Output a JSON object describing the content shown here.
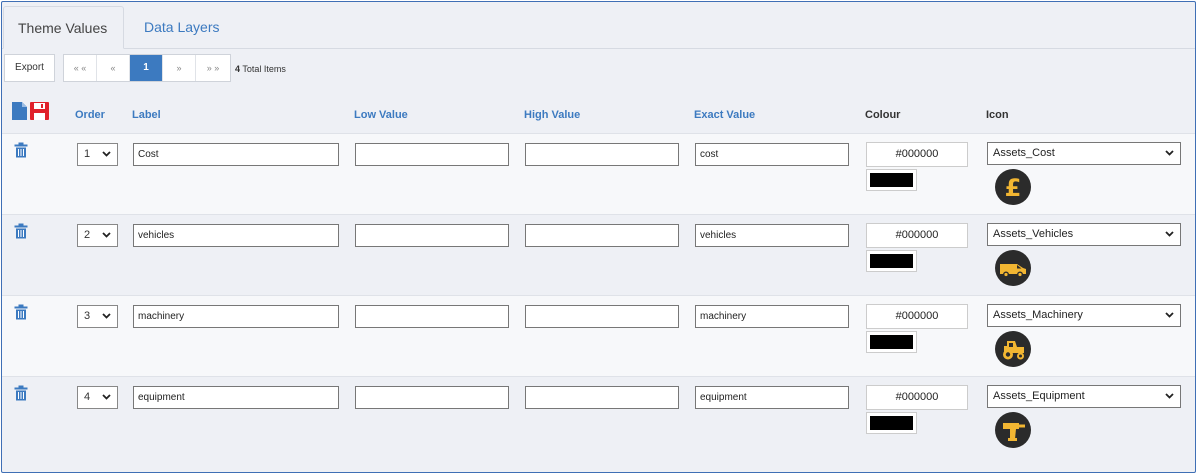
{
  "tabs": {
    "active": "Theme Values",
    "inactive": "Data Layers"
  },
  "toolbar": {
    "export_label": "Export",
    "pager": {
      "first": "«‹",
      "prev": "‹",
      "current": "1",
      "next": "›",
      "last": "››"
    },
    "total_count": "4",
    "total_label": "Total Items"
  },
  "header": {
    "order": "Order",
    "label": "Label",
    "low": "Low Value",
    "high": "High Value",
    "exact": "Exact Value",
    "colour": "Colour",
    "icon": "Icon"
  },
  "rows": [
    {
      "order": "1",
      "label": "Cost",
      "low": "",
      "high": "",
      "exact": "cost",
      "colour": "#000000",
      "icon": "Assets_Cost",
      "icon_glyph": "pound-icon"
    },
    {
      "order": "2",
      "label": "vehicles",
      "low": "",
      "high": "",
      "exact": "vehicles",
      "colour": "#000000",
      "icon": "Assets_Vehicles",
      "icon_glyph": "van-icon"
    },
    {
      "order": "3",
      "label": "machinery",
      "low": "",
      "high": "",
      "exact": "machinery",
      "colour": "#000000",
      "icon": "Assets_Machinery",
      "icon_glyph": "tractor-icon"
    },
    {
      "order": "4",
      "label": "equipment",
      "low": "",
      "high": "",
      "exact": "equipment",
      "colour": "#000000",
      "icon": "Assets_Equipment",
      "icon_glyph": "drill-icon"
    }
  ],
  "colors": {
    "accent": "#3c7ac0",
    "icon_bg": "#2b2b2b",
    "icon_fg": "#f2b632",
    "save_red": "#e0202a"
  }
}
